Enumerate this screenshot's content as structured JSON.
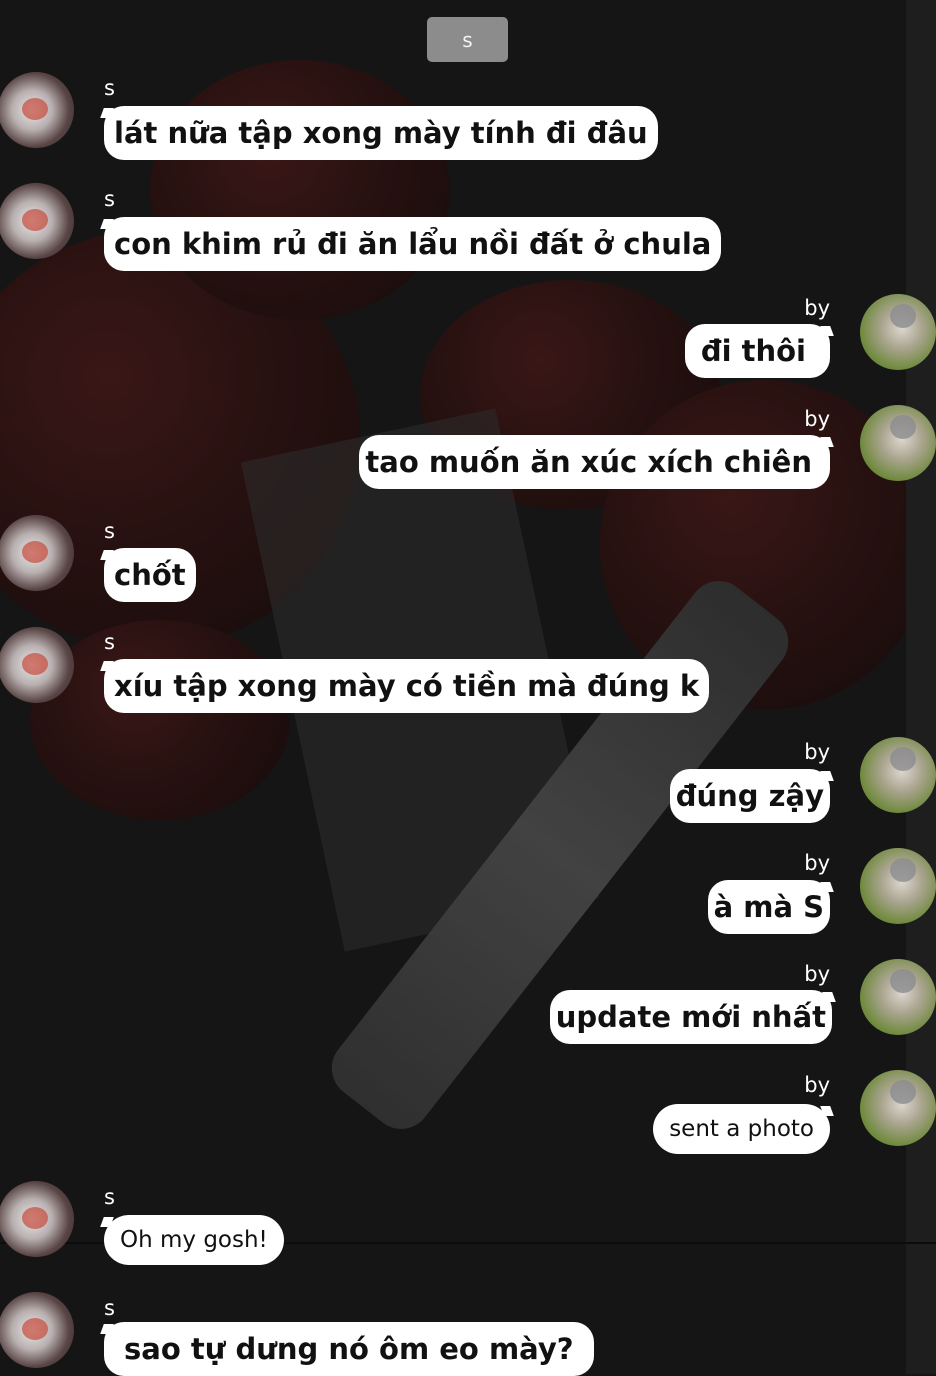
{
  "header": {
    "title_button": "s"
  },
  "messages": [
    {
      "sender": "s",
      "text": "lát nữa tập xong mày tính đi đâu"
    },
    {
      "sender": "s",
      "text": "con khim rủ đi ăn lẩu nồi đất ở chula"
    },
    {
      "sender": "by",
      "text": "đi thôi"
    },
    {
      "sender": "by",
      "text": "tao muốn ăn xúc xích chiên"
    },
    {
      "sender": "s",
      "text": "chốt"
    },
    {
      "sender": "s",
      "text": "xíu tập xong mày có tiền mà đúng k"
    },
    {
      "sender": "by",
      "text": "đúng zậy"
    },
    {
      "sender": "by",
      "text": "à mà S"
    },
    {
      "sender": "by",
      "text": "update mới nhất"
    },
    {
      "sender": "by",
      "text": "sent a photo"
    },
    {
      "sender": "s",
      "text": "Oh my gosh!"
    },
    {
      "sender": "s",
      "text": "sao tự dưng nó ôm eo mày?"
    }
  ]
}
